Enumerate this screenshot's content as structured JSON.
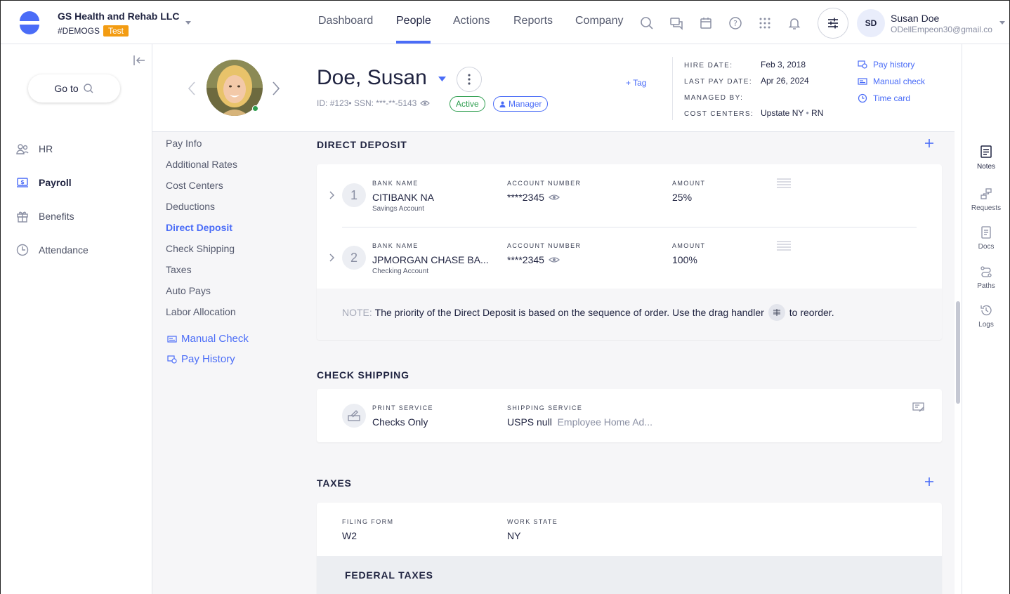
{
  "company": {
    "name": "GS Health and Rehab LLC",
    "code": "#DEMOGS",
    "env_badge": "Test"
  },
  "nav": {
    "items": [
      "Dashboard",
      "People",
      "Actions",
      "Reports",
      "Company"
    ],
    "active": "People"
  },
  "user": {
    "initials": "SD",
    "name": "Susan Doe",
    "email": "ODellEmpeon30@gmail.co"
  },
  "sidebar": {
    "goto_label": "Go to",
    "items": [
      {
        "label": "HR",
        "icon": "people-icon"
      },
      {
        "label": "Payroll",
        "icon": "payroll-icon"
      },
      {
        "label": "Benefits",
        "icon": "gift-icon"
      },
      {
        "label": "Attendance",
        "icon": "clock-icon"
      }
    ]
  },
  "employee": {
    "name": "Doe, Susan",
    "id_label": "ID:",
    "id_value": "#123",
    "ssn_label": "SSN:",
    "ssn_value": "***-**-5143",
    "status": "Active",
    "role": "Manager",
    "tag_label": "+ Tag",
    "hire_date_label": "HIRE DATE:",
    "hire_date": "Feb 3, 2018",
    "last_pay_label": "LAST PAY DATE:",
    "last_pay": "Apr 26, 2024",
    "managed_by_label": "MANAGED BY:",
    "managed_by": "",
    "cost_centers_label": "COST CENTERS:",
    "cost_center_1": "Upstate NY",
    "cost_center_2": "RN",
    "links": [
      "Pay history",
      "Manual check",
      "Time card"
    ]
  },
  "subnav": {
    "items": [
      "Pay Info",
      "Additional Rates",
      "Cost Centers",
      "Deductions",
      "Direct Deposit",
      "Check Shipping",
      "Taxes",
      "Auto Pays",
      "Labor Allocation"
    ],
    "active": "Direct Deposit",
    "extra": [
      "Manual Check",
      "Pay History"
    ]
  },
  "direct_deposit": {
    "title": "DIRECT DEPOSIT",
    "col_bank": "BANK NAME",
    "col_account": "ACCOUNT NUMBER",
    "col_amount": "AMOUNT",
    "rows": [
      {
        "num": "1",
        "bank": "CITIBANK NA",
        "type": "Savings Account",
        "account": "****2345",
        "amount": "25%"
      },
      {
        "num": "2",
        "bank": "JPMORGAN CHASE BA...",
        "type": "Checking Account",
        "account": "****2345",
        "amount": "100%"
      }
    ],
    "note_label": "NOTE:",
    "note_text_1": "The priority of the Direct Deposit is based on the sequence of order. Use the drag handler",
    "note_text_2": "to reorder."
  },
  "check_shipping": {
    "title": "CHECK SHIPPING",
    "print_label": "PRINT SERVICE",
    "print_value": "Checks Only",
    "ship_label": "SHIPPING SERVICE",
    "ship_value": "USPS null",
    "ship_addr": "Employee Home Ad..."
  },
  "taxes": {
    "title": "TAXES",
    "filing_label": "FILING FORM",
    "filing_value": "W2",
    "state_label": "WORK STATE",
    "state_value": "NY",
    "federal_title": "FEDERAL TAXES"
  },
  "rail": [
    "Notes",
    "Requests",
    "Docs",
    "Paths",
    "Logs"
  ],
  "colors": {
    "accent": "#4a6cf7",
    "active_green": "#2e9e4f",
    "test_badge": "#f39c12"
  }
}
